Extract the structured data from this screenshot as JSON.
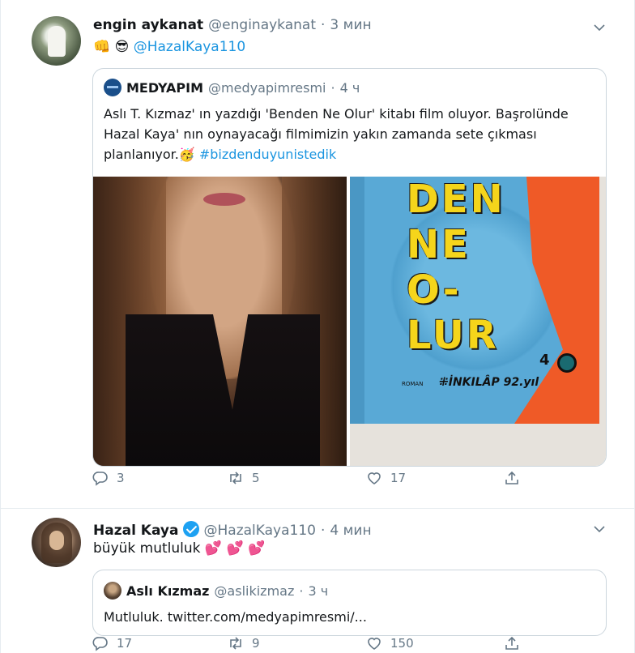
{
  "tweets": [
    {
      "author_name": "engin aykanat",
      "author_handle": "@enginaykanat",
      "separator": "·",
      "time": "3 мин",
      "emojis": "👊 😎",
      "mention": "@HazalKaya110",
      "quote": {
        "author_name": "MEDYAPIM",
        "author_handle": "@medyapimresmi",
        "separator": "·",
        "time": "4 ч",
        "text_lines": [
          "Aslı T. Kızmaz' ın yazdığı 'Benden Ne Olur' kitabı film oluyor. Başrolünde",
          "Hazal Kaya' nın oynayacağı filmimizin yakın zamanda sete çıkması",
          "planlanıyor."
        ],
        "text_emoji": "🥳",
        "hashtag": " #bizdenduyunistedik",
        "book_title": "DEN\nNE\nO-\nLUR",
        "book_publisher": "⁜İNKILÂP 92.yıl",
        "book_number": "4",
        "book_genre": "ROMAN"
      },
      "actions": {
        "replies": "3",
        "retweets": "5",
        "likes": "17"
      }
    },
    {
      "author_name": "Hazal Kaya",
      "author_handle": "@HazalKaya110",
      "separator": "·",
      "time": "4 мин",
      "text": "büyük mutluluk",
      "emojis": "💕 💕 💕",
      "quote": {
        "author_name": "Aslı Kızmaz",
        "author_handle": "@aslikizmaz",
        "separator": "·",
        "time": "3 ч",
        "text": "Mutluluk. twitter.com/medyapimresmi/..."
      },
      "actions": {
        "replies": "17",
        "retweets": "9",
        "likes": "150"
      }
    }
  ],
  "icons": {
    "caret": "chevron-down-icon",
    "reply": "reply-icon",
    "retweet": "retweet-icon",
    "like": "heart-icon",
    "share": "share-icon",
    "verified": "verified-badge-icon"
  },
  "colors": {
    "link": "#1b95e0",
    "muted": "#657786",
    "border": "#ccd6dd",
    "verified": "#1da1f2"
  }
}
